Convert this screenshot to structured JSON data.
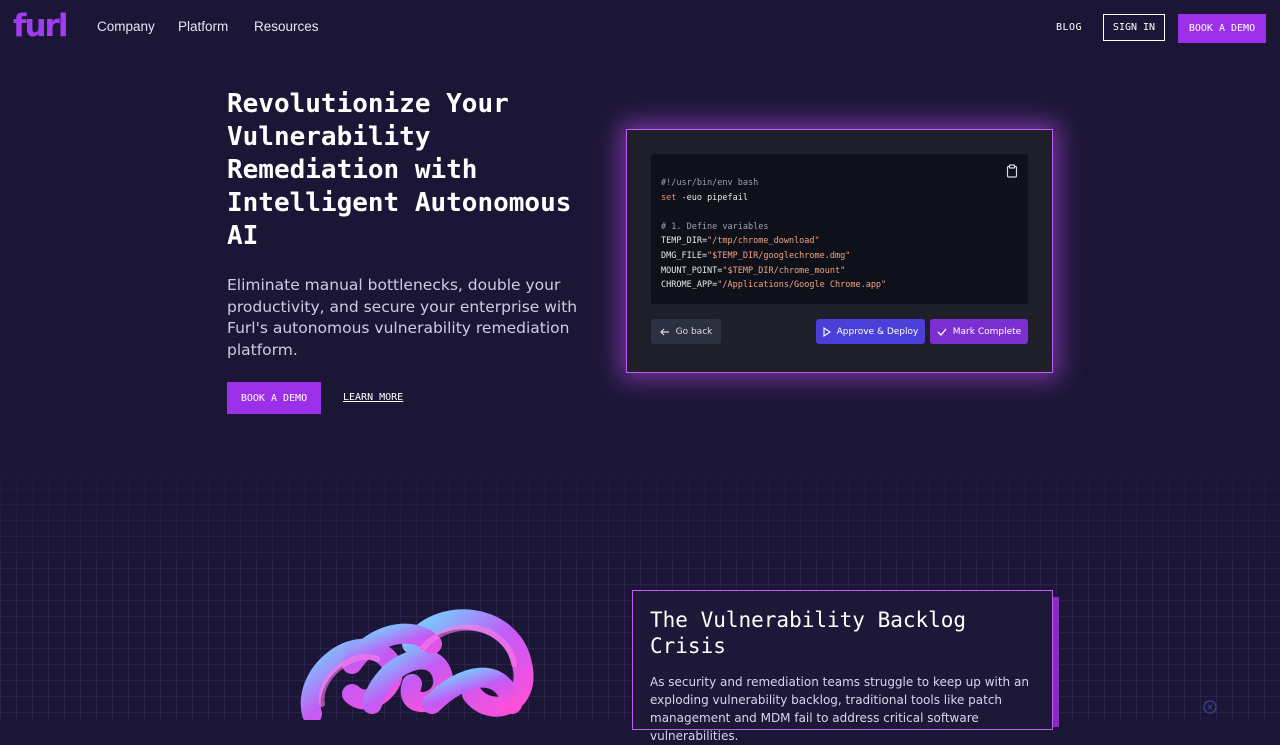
{
  "nav": {
    "logo": "furl",
    "links": [
      "Company",
      "Platform",
      "Resources"
    ],
    "blog": "BLOG",
    "sign_in": "SIGN IN",
    "book_demo": "BOOK A DEMO"
  },
  "hero": {
    "title": "Revolutionize Your Vulnerability Remediation with Intelligent Autonomous AI",
    "subtitle": "Eliminate manual bottlenecks, double your productivity, and secure your enterprise with Furl's autonomous vulnerability remediation platform.",
    "book_demo": "BOOK A DEMO",
    "learn_more": "LEARN MORE"
  },
  "code_card": {
    "lines": [
      "#!/usr/bin/env bash",
      "set -euo pipefail",
      "",
      "# 1. Define variables",
      "TEMP_DIR=\"/tmp/chrome_download\"",
      "DMG_FILE=\"$TEMP_DIR/googlechrome.dmg\"",
      "MOUNT_POINT=\"$TEMP_DIR/chrome_mount\"",
      "CHROME_APP=\"/Applications/Google Chrome.app\""
    ],
    "go_back": "Go back",
    "approve": "Approve & Deploy",
    "complete": "Mark Complete"
  },
  "backlog": {
    "title": "The Vulnerability Backlog Crisis",
    "text": "As security and remediation teams struggle to keep up with an exploding vulnerability backlog, traditional tools like patch management and MDM fail to address critical software vulnerabilities."
  },
  "colors": {
    "accent": "#9b30e8",
    "background": "#1b1636",
    "glow": "#c35bf5",
    "approve": "#4a3fd8"
  }
}
